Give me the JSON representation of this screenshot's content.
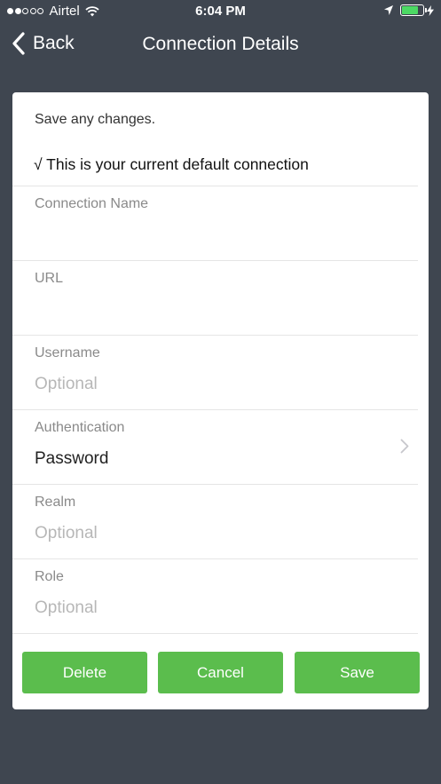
{
  "status_bar": {
    "carrier": "Airtel",
    "time": "6:04 PM",
    "signal_bars_filled": 2,
    "signal_bars_total": 5,
    "battery_level": 0.8,
    "battery_color": "#4cd964",
    "icons": [
      "wifi-icon",
      "location-arrow-icon",
      "battery-icon",
      "charging-bolt-icon"
    ]
  },
  "nav": {
    "back_label": "Back",
    "title": "Connection Details",
    "back_icon": "chevron-left-icon"
  },
  "form": {
    "save_note": "Save any changes.",
    "default_note": "√ This is your current default connection",
    "fields": {
      "connection_name": {
        "label": "Connection Name",
        "value": "",
        "placeholder": ""
      },
      "url": {
        "label": "URL",
        "value": "",
        "placeholder": ""
      },
      "username": {
        "label": "Username",
        "value": "",
        "placeholder": "Optional"
      },
      "authentication": {
        "label": "Authentication",
        "value": "Password",
        "icon": "chevron-right-icon"
      },
      "realm": {
        "label": "Realm",
        "value": "",
        "placeholder": "Optional"
      },
      "role": {
        "label": "Role",
        "value": "",
        "placeholder": "Optional"
      }
    }
  },
  "actions": {
    "delete_label": "Delete",
    "cancel_label": "Cancel",
    "save_label": "Save"
  },
  "colors": {
    "background": "#3f4650",
    "card": "#ffffff",
    "button": "#5bbd4d",
    "label": "#8a8a8a",
    "placeholder": "#b7b7b7"
  }
}
